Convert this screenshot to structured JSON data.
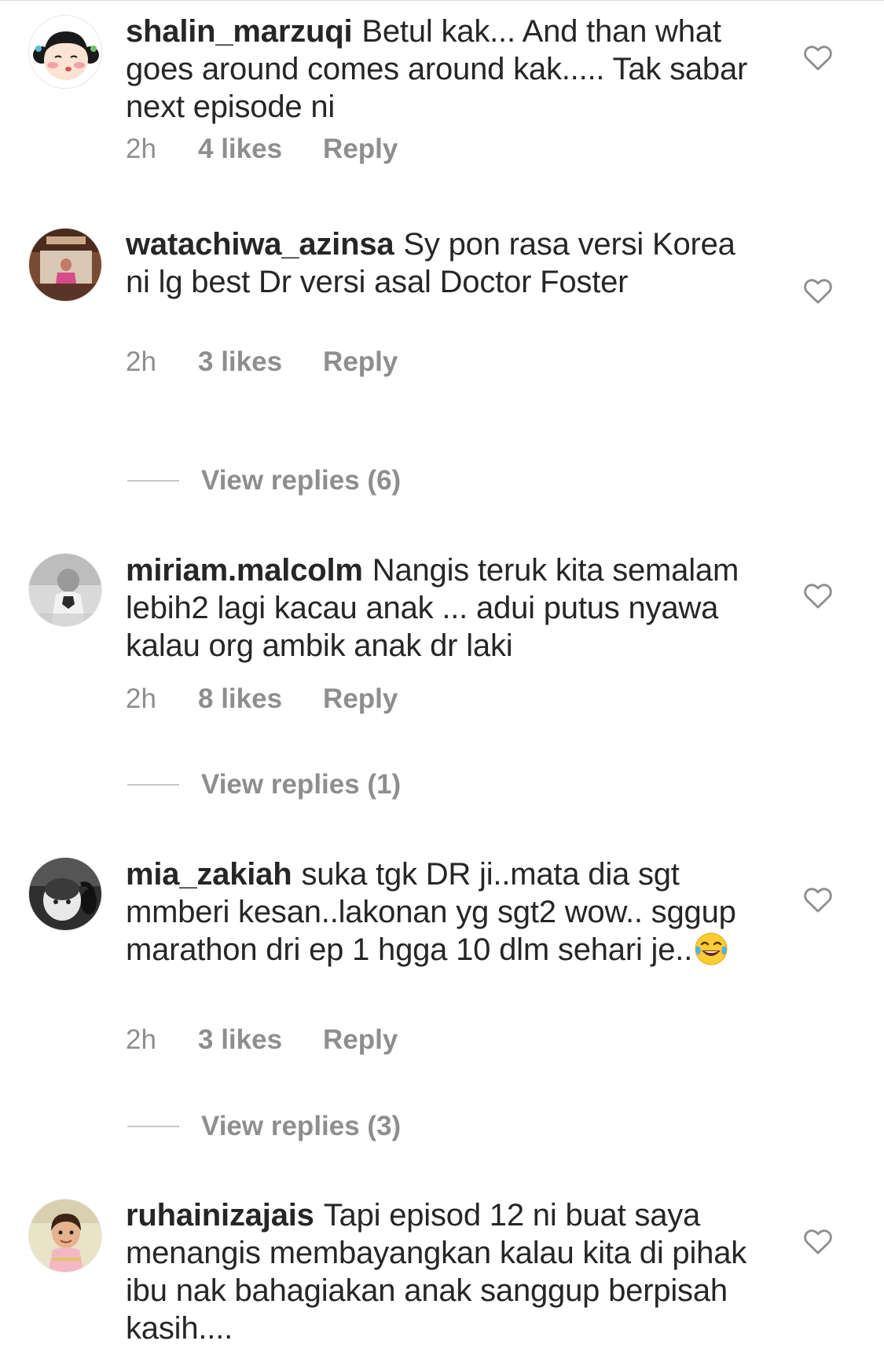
{
  "comments": [
    {
      "username": "shalin_marzuqi",
      "text": "Betul kak... And than what goes around comes around kak..... Tak sabar next episode ni",
      "time": "2h",
      "likes": "4 likes",
      "reply": "Reply",
      "avatar_icon": "cartoon-girl-avatar-icon"
    },
    {
      "username": "watachiwa_azinsa",
      "text": "Sy pon rasa versi Korea ni lg best Dr versi asal Doctor Foster",
      "time": "2h",
      "likes": "3 likes",
      "reply": "Reply",
      "view_replies": "View replies (6)",
      "avatar_icon": "photo-avatar-icon"
    },
    {
      "username": "miriam.malcolm",
      "text": "Nangis teruk kita semalam lebih2 lagi kacau anak ... adui putus nyawa kalau org ambik anak dr laki",
      "time": "2h",
      "likes": "8 likes",
      "reply": "Reply",
      "view_replies": "View replies (1)",
      "avatar_icon": "photo-avatar-icon"
    },
    {
      "username": "mia_zakiah",
      "text": "suka tgk DR ji..mata dia sgt mmberi kesan..lakonan yg sgt2 wow.. sggup marathon dri ep 1 hgga 10 dlm sehari je..",
      "emoji": "face-with-tears-of-joy-emoji",
      "time": "2h",
      "likes": "3 likes",
      "reply": "Reply",
      "view_replies": "View replies (3)",
      "avatar_icon": "photo-avatar-icon"
    },
    {
      "username": "ruhainizajais",
      "text": "Tapi episod 12 ni buat saya menangis membayangkan kalau kita di pihak ibu nak bahagiakan anak sanggup berpisah kasih....",
      "avatar_icon": "photo-avatar-icon"
    }
  ],
  "icons": {
    "like": "heart-outline-icon"
  },
  "colors": {
    "text": "#262626",
    "secondary_text": "#8e8e8e",
    "divider": "#c7c7c7",
    "background": "#ffffff"
  }
}
